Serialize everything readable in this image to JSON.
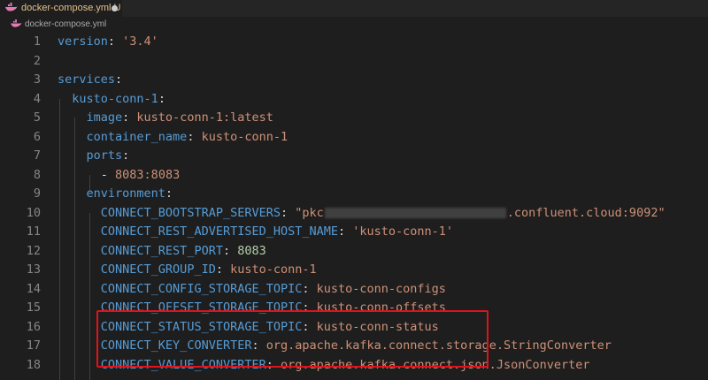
{
  "tab": {
    "filename": "docker-compose.yml",
    "git_status": "U"
  },
  "breadcrumb": {
    "filename": "docker-compose.yml"
  },
  "icons": {
    "file_icon": "docker-whale-icon",
    "unsaved_indicator": "dot-icon"
  },
  "colors": {
    "key": "#569cd6",
    "string": "#ce9178",
    "number": "#b5cea8",
    "punctuation": "#d4d4d4",
    "line_number": "#858585",
    "highlight_box": "#e0121b",
    "background": "#1e1e1e"
  },
  "lines": [
    {
      "num": "1",
      "key": "version",
      "sep": ": ",
      "val": "'3.4'"
    },
    {
      "num": "2"
    },
    {
      "num": "3",
      "key": "services",
      "sep": ":"
    },
    {
      "num": "4",
      "indent": "  ",
      "key": "kusto-conn-1",
      "sep": ":"
    },
    {
      "num": "5",
      "indent": "    ",
      "key": "image",
      "sep": ": ",
      "val": "kusto-conn-1:latest"
    },
    {
      "num": "6",
      "indent": "    ",
      "key": "container_name",
      "sep": ": ",
      "val": "kusto-conn-1"
    },
    {
      "num": "7",
      "indent": "    ",
      "key": "ports",
      "sep": ":"
    },
    {
      "num": "8",
      "indent": "      ",
      "dash": "- ",
      "val": "8083:8083"
    },
    {
      "num": "9",
      "indent": "    ",
      "key": "environment",
      "sep": ":"
    },
    {
      "num": "10",
      "indent": "      ",
      "key": "CONNECT_BOOTSTRAP_SERVERS",
      "sep": ": ",
      "val": "\"pkc",
      "redacted": true,
      "val2": ".confluent.cloud:9092\""
    },
    {
      "num": "11",
      "indent": "      ",
      "key": "CONNECT_REST_ADVERTISED_HOST_NAME",
      "sep": ": ",
      "val": "'kusto-conn-1'"
    },
    {
      "num": "12",
      "indent": "      ",
      "key": "CONNECT_REST_PORT",
      "sep": ": ",
      "num_val": "8083"
    },
    {
      "num": "13",
      "indent": "      ",
      "key": "CONNECT_GROUP_ID",
      "sep": ": ",
      "val": "kusto-conn-1"
    },
    {
      "num": "14",
      "indent": "      ",
      "key": "CONNECT_CONFIG_STORAGE_TOPIC",
      "sep": ": ",
      "val": "kusto-conn-configs"
    },
    {
      "num": "15",
      "indent": "      ",
      "key": "CONNECT_OFFSET_STORAGE_TOPIC",
      "sep": ": ",
      "val": "kusto-conn-offsets"
    },
    {
      "num": "16",
      "indent": "      ",
      "key": "CONNECT_STATUS_STORAGE_TOPIC",
      "sep": ": ",
      "val": "kusto-conn-status"
    },
    {
      "num": "17",
      "indent": "      ",
      "key": "CONNECT_KEY_CONVERTER",
      "sep": ": ",
      "val": "org.apache.kafka.connect.storage.StringConverter"
    },
    {
      "num": "18",
      "indent": "      ",
      "key": "CONNECT_VALUE_CONVERTER",
      "sep": ": ",
      "val": "org.apache.kafka.connect.json.JsonConverter"
    }
  ]
}
